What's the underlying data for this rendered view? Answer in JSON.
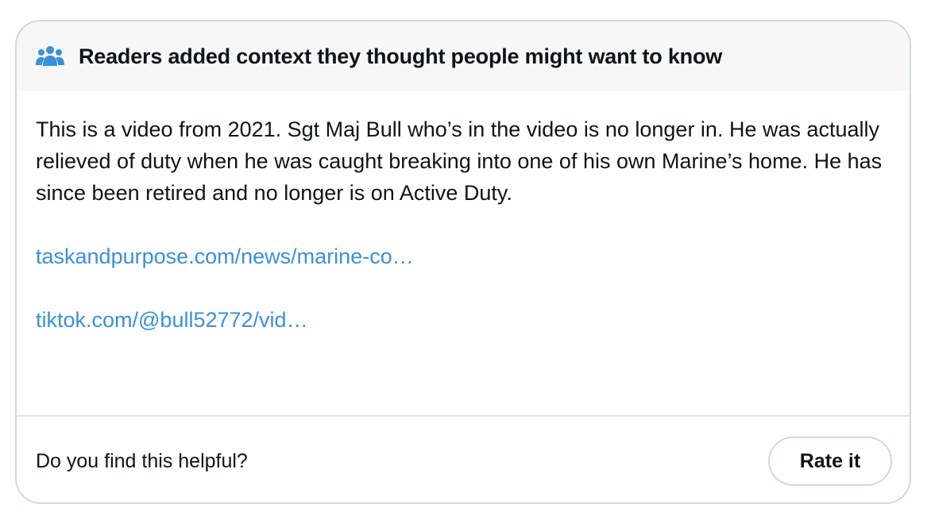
{
  "header": {
    "icon": "people-group-icon",
    "title": "Readers added context they thought people might want to know"
  },
  "note": {
    "text": "This is a video from 2021. Sgt Maj Bull who’s in the video is no longer in. He was actually relieved of duty when he was caught breaking into one of his own Marine’s home. He has since been retired and no longer is on Active Duty.",
    "links": [
      "taskandpurpose.com/news/marine-co…",
      "tiktok.com/@bull52772/vid…"
    ]
  },
  "footer": {
    "question": "Do you find this helpful?",
    "rate_label": "Rate it"
  },
  "colors": {
    "link": "#3a90d9",
    "icon": "#3a90d9",
    "header_bg": "#f7f7f7",
    "border": "#cfd9de"
  }
}
